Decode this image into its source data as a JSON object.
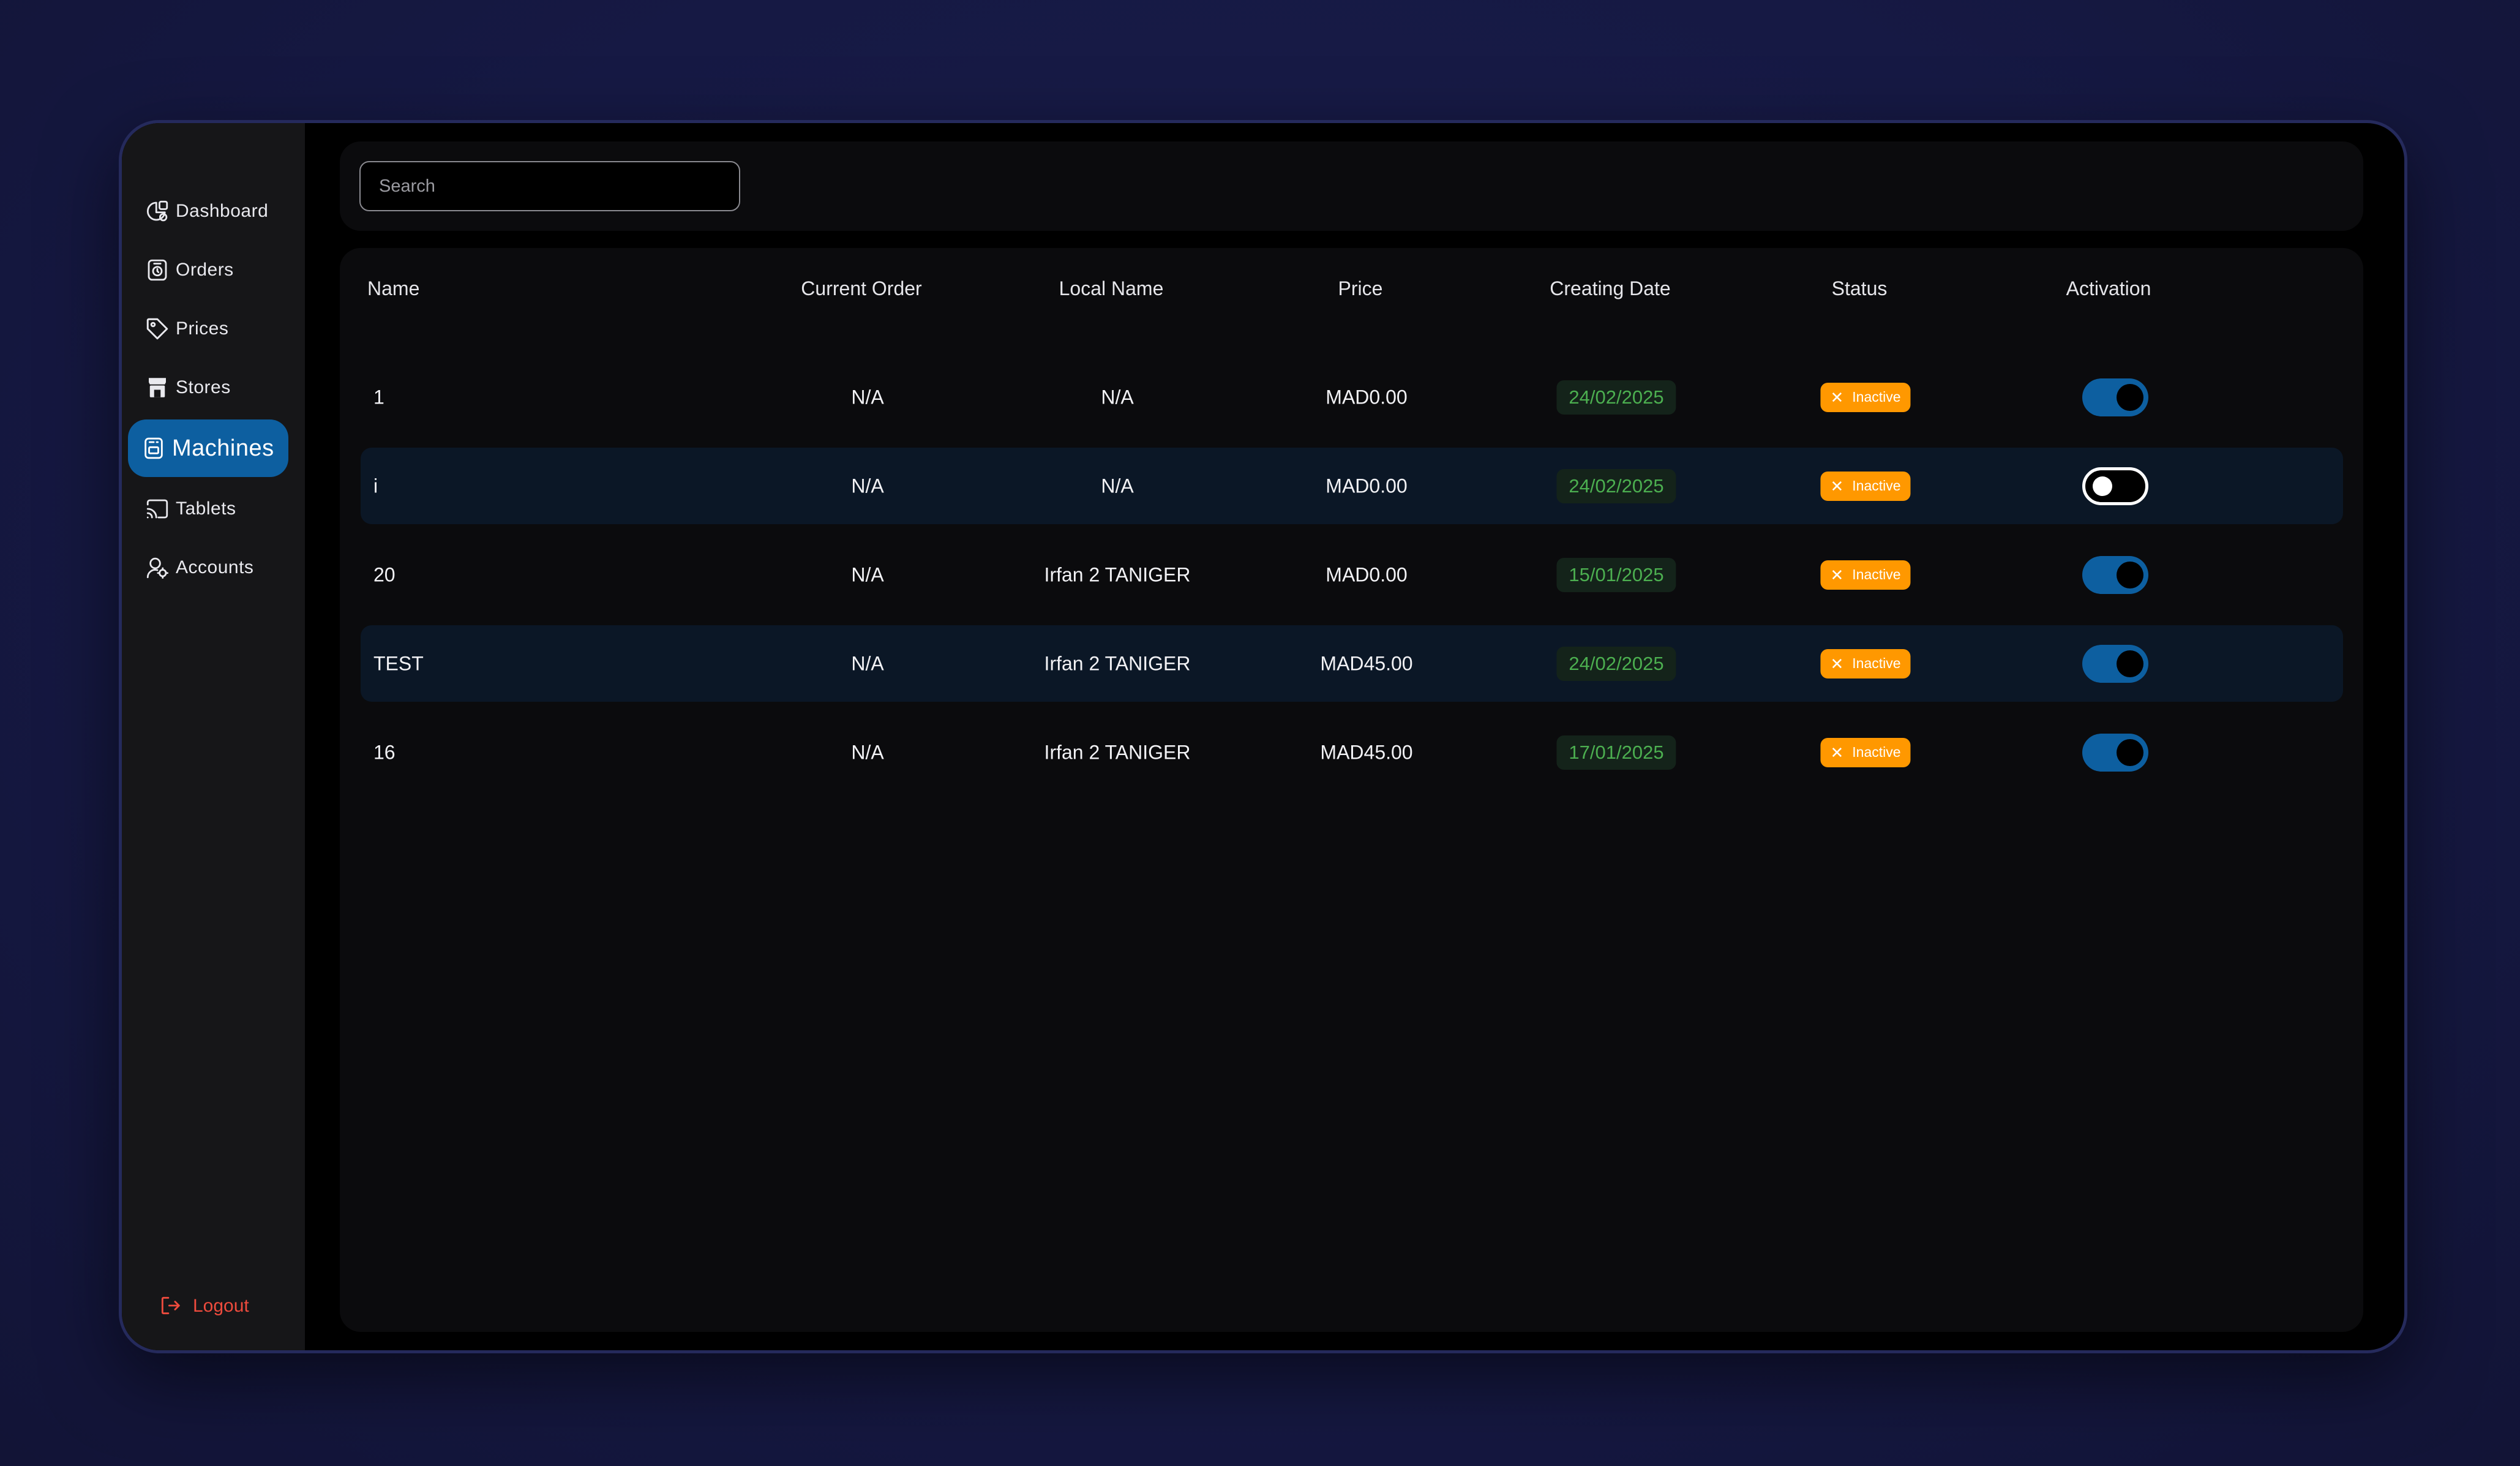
{
  "sidebar": {
    "items": [
      {
        "label": "Dashboard",
        "icon": "dashboard-icon"
      },
      {
        "label": "Orders",
        "icon": "orders-icon"
      },
      {
        "label": "Prices",
        "icon": "price-tag-icon"
      },
      {
        "label": "Stores",
        "icon": "store-icon"
      },
      {
        "label": "Machines",
        "icon": "machine-icon",
        "active": true
      },
      {
        "label": "Tablets",
        "icon": "tablet-cast-icon"
      },
      {
        "label": "Accounts",
        "icon": "accounts-icon"
      }
    ],
    "logout_label": "Logout",
    "logout_icon": "logout-icon"
  },
  "search": {
    "placeholder": "Search",
    "value": ""
  },
  "table": {
    "columns": [
      "Name",
      "Current Order",
      "Local Name",
      "Price",
      "Creating Date",
      "Status",
      "Activation"
    ],
    "rows": [
      {
        "name": "1",
        "current_order": "N/A",
        "local_name": "N/A",
        "price": "MAD0.00",
        "date": "24/02/2025",
        "status": "Inactive",
        "activation": true
      },
      {
        "name": "i",
        "current_order": "N/A",
        "local_name": "N/A",
        "price": "MAD0.00",
        "date": "24/02/2025",
        "status": "Inactive",
        "activation": false
      },
      {
        "name": "20",
        "current_order": "N/A",
        "local_name": "Irfan 2 TANIGER",
        "price": "MAD0.00",
        "date": "15/01/2025",
        "status": "Inactive",
        "activation": true
      },
      {
        "name": "TEST",
        "current_order": "N/A",
        "local_name": "Irfan 2 TANIGER",
        "price": "MAD45.00",
        "date": "24/02/2025",
        "status": "Inactive",
        "activation": true
      },
      {
        "name": "16",
        "current_order": "N/A",
        "local_name": "Irfan 2 TANIGER",
        "price": "MAD45.00",
        "date": "17/01/2025",
        "status": "Inactive",
        "activation": true
      }
    ]
  },
  "colors": {
    "accent": "#0d5fa0",
    "status_inactive": "#ff9800",
    "date_text": "#4caf50",
    "logout": "#ee4b3d",
    "row_stripe": "#0b1726"
  }
}
